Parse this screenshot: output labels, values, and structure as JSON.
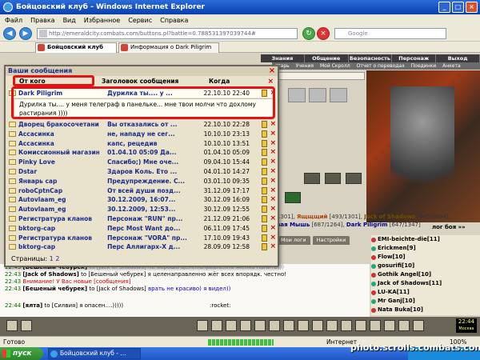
{
  "window": {
    "title": "Бойцовский клуб - Windows Internet Explorer"
  },
  "menu": [
    "Файл",
    "Правка",
    "Вид",
    "Избранное",
    "Сервис",
    "Справка"
  ],
  "address": {
    "url": "http://emeraldcity.combats.com/buttons.pl?battle=0.788531397039744#",
    "search_placeholder": "Google"
  },
  "tabs": [
    {
      "label": "Бойцовский клуб"
    },
    {
      "label": "Информация о Dark Piligrim"
    }
  ],
  "game_nav": [
    "Знания",
    "Общение",
    "Безопасность",
    "Персонаж",
    "Выход"
  ],
  "game_subnav": [
    "гтарь",
    "Учения",
    "Мой Скролл",
    "Отчет о переводах",
    "Поединки",
    "Анкета"
  ],
  "dialog": {
    "title": "Ваши сообщения",
    "columns": {
      "from": "От кого",
      "subject": "Заголовок сообщения",
      "when": "Когда"
    },
    "selected_body": "Дурилка ты.... у меня телеграф в панельке... мне твои молчи что дохлому растирания ))))",
    "messages": [
      {
        "from": "Dark Piligrim",
        "subject": "Дурилка ты.... у ...",
        "date": "22.10.10 22:40"
      },
      {
        "from": "Дворец бракосочетаний",
        "subject": "Вы отказались от ...",
        "date": "22.10.10 22:28"
      },
      {
        "from": "Ассасинка",
        "subject": "не, нападу не сег...",
        "date": "10.10.10 23:13"
      },
      {
        "from": "Ассасинка",
        "subject": "капс, рецедив",
        "date": "10.10.10 13:51"
      },
      {
        "from": "Комиссионный магазин",
        "subject": "01.04.10 05:09 Да...",
        "date": "01.04.10 05:09"
      },
      {
        "from": "Pinky Love",
        "subject": "Спасибо;) Мне оче...",
        "date": "09.04.10 15:44"
      },
      {
        "from": "Dstar",
        "subject": "Здаров Коль. Ето ...",
        "date": "04.01.10 14:27"
      },
      {
        "from": "Январь cap",
        "subject": "Предупреждение. С...",
        "date": "03.01.10 09:35"
      },
      {
        "from": "roboCptnCap",
        "subject": "От всей души позд...",
        "date": "31.12.09 17:17"
      },
      {
        "from": "Autovlaam_eg",
        "subject": "30.12.2009, 16:07...",
        "date": "30.12.09 16:09"
      },
      {
        "from": "Autovlaam_eg",
        "subject": "30.12.2009, 12:53...",
        "date": "30.12.09 12:55"
      },
      {
        "from": "Регистратура кланов",
        "subject": "Персонаж \"RUN\" пр...",
        "date": "21.12.09 21:06"
      },
      {
        "from": "bktorg-cap",
        "subject": "Перс Most Want до...",
        "date": "06.11.09 17:45"
      },
      {
        "from": "Регистратура кланов",
        "subject": "Персонаж \"VORA\" пр...",
        "date": "17.10.09 19:43"
      },
      {
        "from": "bktorg-cap",
        "subject": "Перс Аллигарх-Х д...",
        "date": "28.09.09 12:58"
      }
    ],
    "pages_label": "Страницы:",
    "pages": [
      "1",
      "2"
    ]
  },
  "char_line": {
    "pre": "1301], ",
    "n1": "Ящщщий",
    "n1_stats": " [493/1301], ",
    "n2": "Jack of Shadows",
    "n2_stats": " [945/1604],",
    "n3": "вая Мышь",
    "n3_stats": " [687/1264], ",
    "n4": "Dark Piligrim",
    "n4_stats": " [647/1347]",
    "log_label": "лог боя »»"
  },
  "log_tabs": [
    "Мои логи",
    "Настройки"
  ],
  "chat": [
    {
      "time": "22:43",
      "nick": "[Бешеный чебурек]",
      "to": " to [Jack of Shadows] ",
      "text": "не хорошо целенаправленно жёнка палить)))",
      "style": "grey"
    },
    {
      "time": "22:43",
      "nick": "[Jack of Shadows]",
      "to": " to [Бешеный чебурек] ",
      "text": "я целенаправленно жёг всех впорядк. честно!",
      "style": "normal"
    },
    {
      "time": "22:43",
      "nick": "",
      "to": "",
      "text": "Внимание! У Вас новые [сообщения]",
      "style": "alert"
    },
    {
      "time": "22:43",
      "nick": "[Бешеный чебурек]",
      "to": " to [Jack of Shadows] ",
      "text": "врать не красиво) я видел))",
      "style": "mixed"
    }
  ],
  "chat_input": {
    "time": "22:44",
    "nick": "[ялта]",
    "text": " to [Силвия] я опасен....)))))",
    "emote": ":rocket:"
  },
  "users": [
    "EMI-beichte-die[11]",
    "Erickmen[9]",
    "Flow[10]",
    "gosurifi[10]",
    "Gothik Angel[10]",
    "Jack of Shadows[11]",
    "LU-KA[11]",
    "Mr Ganj[10]",
    "Nata Buka[10]"
  ],
  "clock": {
    "time": "22:44",
    "label": "Москва"
  },
  "status": {
    "left": "Готово",
    "zone": "Интернет",
    "zoom": "100%"
  },
  "taskbar": {
    "start": "пуск",
    "item": "Бойцовский клуб - ..."
  },
  "watermark": "photo.scrolls.combats.com"
}
